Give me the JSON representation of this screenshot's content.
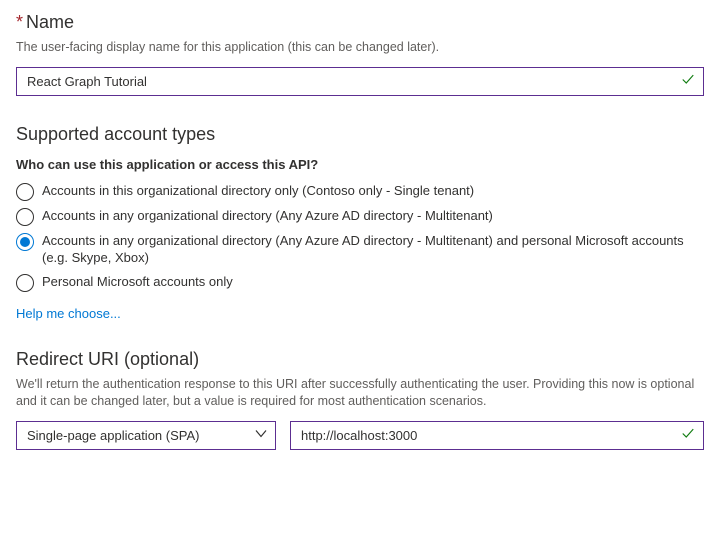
{
  "name": {
    "title": "Name",
    "description": "The user-facing display name for this application (this can be changed later).",
    "value": "React Graph Tutorial"
  },
  "accountTypes": {
    "title": "Supported account types",
    "question": "Who can use this application or access this API?",
    "options": [
      {
        "label": "Accounts in this organizational directory only (Contoso only - Single tenant)",
        "selected": false
      },
      {
        "label": "Accounts in any organizational directory (Any Azure AD directory - Multitenant)",
        "selected": false
      },
      {
        "label": "Accounts in any organizational directory (Any Azure AD directory - Multitenant) and personal Microsoft accounts (e.g. Skype, Xbox)",
        "selected": true
      },
      {
        "label": "Personal Microsoft accounts only",
        "selected": false
      }
    ],
    "helpLink": "Help me choose..."
  },
  "redirect": {
    "title": "Redirect URI (optional)",
    "description": "We'll return the authentication response to this URI after successfully authenticating the user. Providing this now is optional and it can be changed later, but a value is required for most authentication scenarios.",
    "platformSelected": "Single-page application (SPA)",
    "uriValue": "http://localhost:3000"
  }
}
